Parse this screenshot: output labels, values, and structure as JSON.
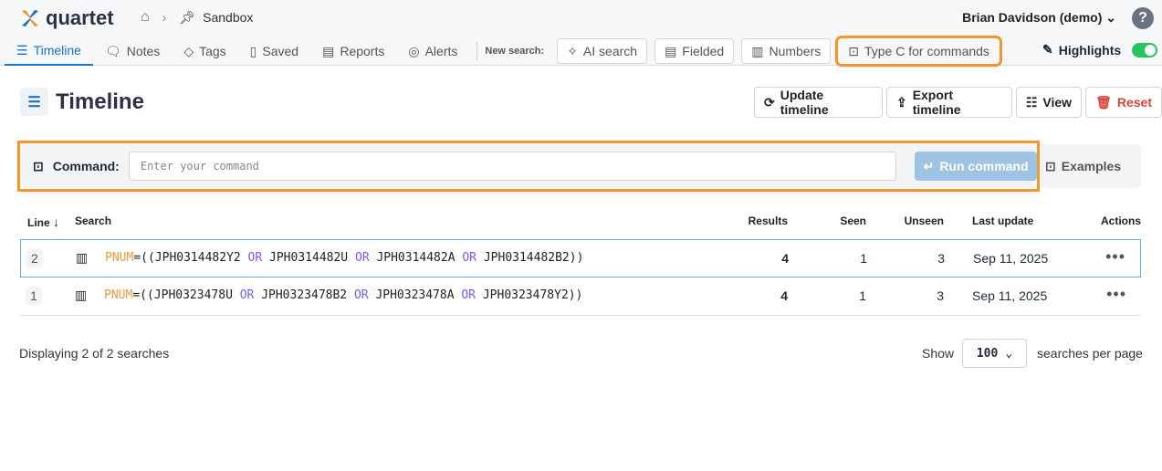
{
  "app": {
    "logo": "quartet",
    "breadcrumb": "Sandbox",
    "user": "Brian Davidson (demo)",
    "help": "?"
  },
  "nav": {
    "tabs": [
      "Timeline",
      "Notes",
      "Tags",
      "Saved",
      "Reports",
      "Alerts"
    ],
    "new_search_label": "New search:",
    "search_buttons": [
      "AI search",
      "Fielded",
      "Numbers",
      "Type C for commands"
    ],
    "highlights": "Highlights",
    "highlights_on": true
  },
  "page": {
    "title": "Timeline",
    "actions": {
      "update": "Update timeline",
      "export": "Export timeline",
      "view": "View",
      "reset": "Reset"
    }
  },
  "command": {
    "label": "Command:",
    "placeholder": "Enter your command",
    "value": "",
    "run": "Run command",
    "examples": "Examples"
  },
  "table": {
    "headers": {
      "line": "Line",
      "search": "Search",
      "results": "Results",
      "seen": "Seen",
      "unseen": "Unseen",
      "last_update": "Last update",
      "actions": "Actions"
    },
    "rows": [
      {
        "line": "2",
        "field": "PNUM",
        "eq": "=((",
        "terms": [
          "JPH0314482Y2",
          "JPH0314482U",
          "JPH0314482A",
          "JPH0314482B2"
        ],
        "op": "OR",
        "close": "))",
        "results": "4",
        "seen": "1",
        "unseen": "3",
        "last_update": "Sep 11, 2025",
        "selected": true
      },
      {
        "line": "1",
        "field": "PNUM",
        "eq": "=((",
        "terms": [
          "JPH0323478U",
          "JPH0323478B2",
          "JPH0323478A",
          "JPH0323478Y2"
        ],
        "op": "OR",
        "close": "))",
        "results": "4",
        "seen": "1",
        "unseen": "3",
        "last_update": "Sep 11, 2025",
        "selected": false
      }
    ]
  },
  "footer": {
    "displaying": "Displaying 2 of 2 searches",
    "show": "Show",
    "per_page": "100",
    "per_page_suffix": "searches per page"
  },
  "colors": {
    "accent": "#1a73c7",
    "highlight_outline": "#f0962b",
    "reset": "#d9443a",
    "keyword": "#f29a38",
    "operator": "#7a5af8"
  }
}
